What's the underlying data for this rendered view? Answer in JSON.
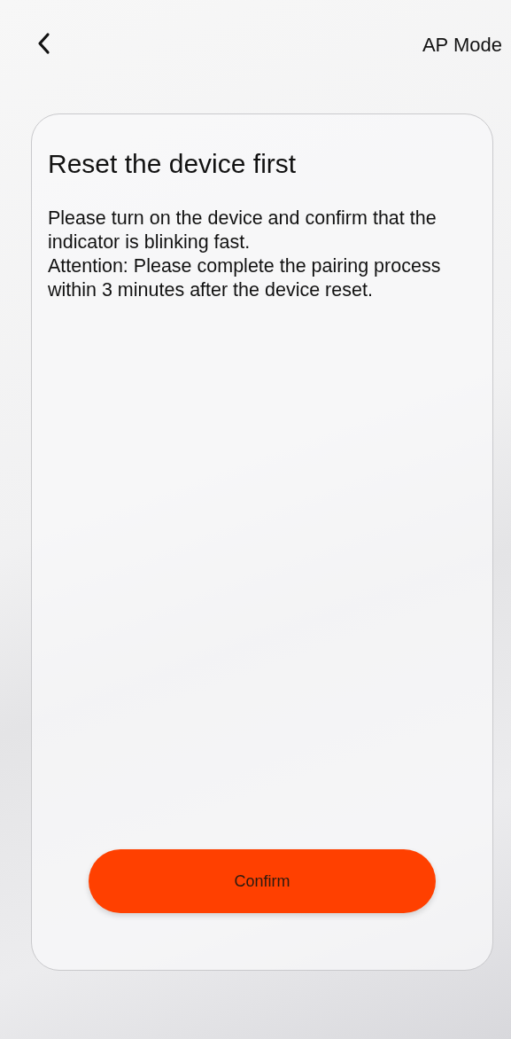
{
  "header": {
    "mode_link": "AP Mode"
  },
  "card": {
    "title": "Reset the device first",
    "paragraphs": [
      "Please turn on the device and confirm that the indicator is blinking fast.",
      "Attention: Please complete the pairing process within 3 minutes after the device reset."
    ],
    "button": "Confirm"
  }
}
